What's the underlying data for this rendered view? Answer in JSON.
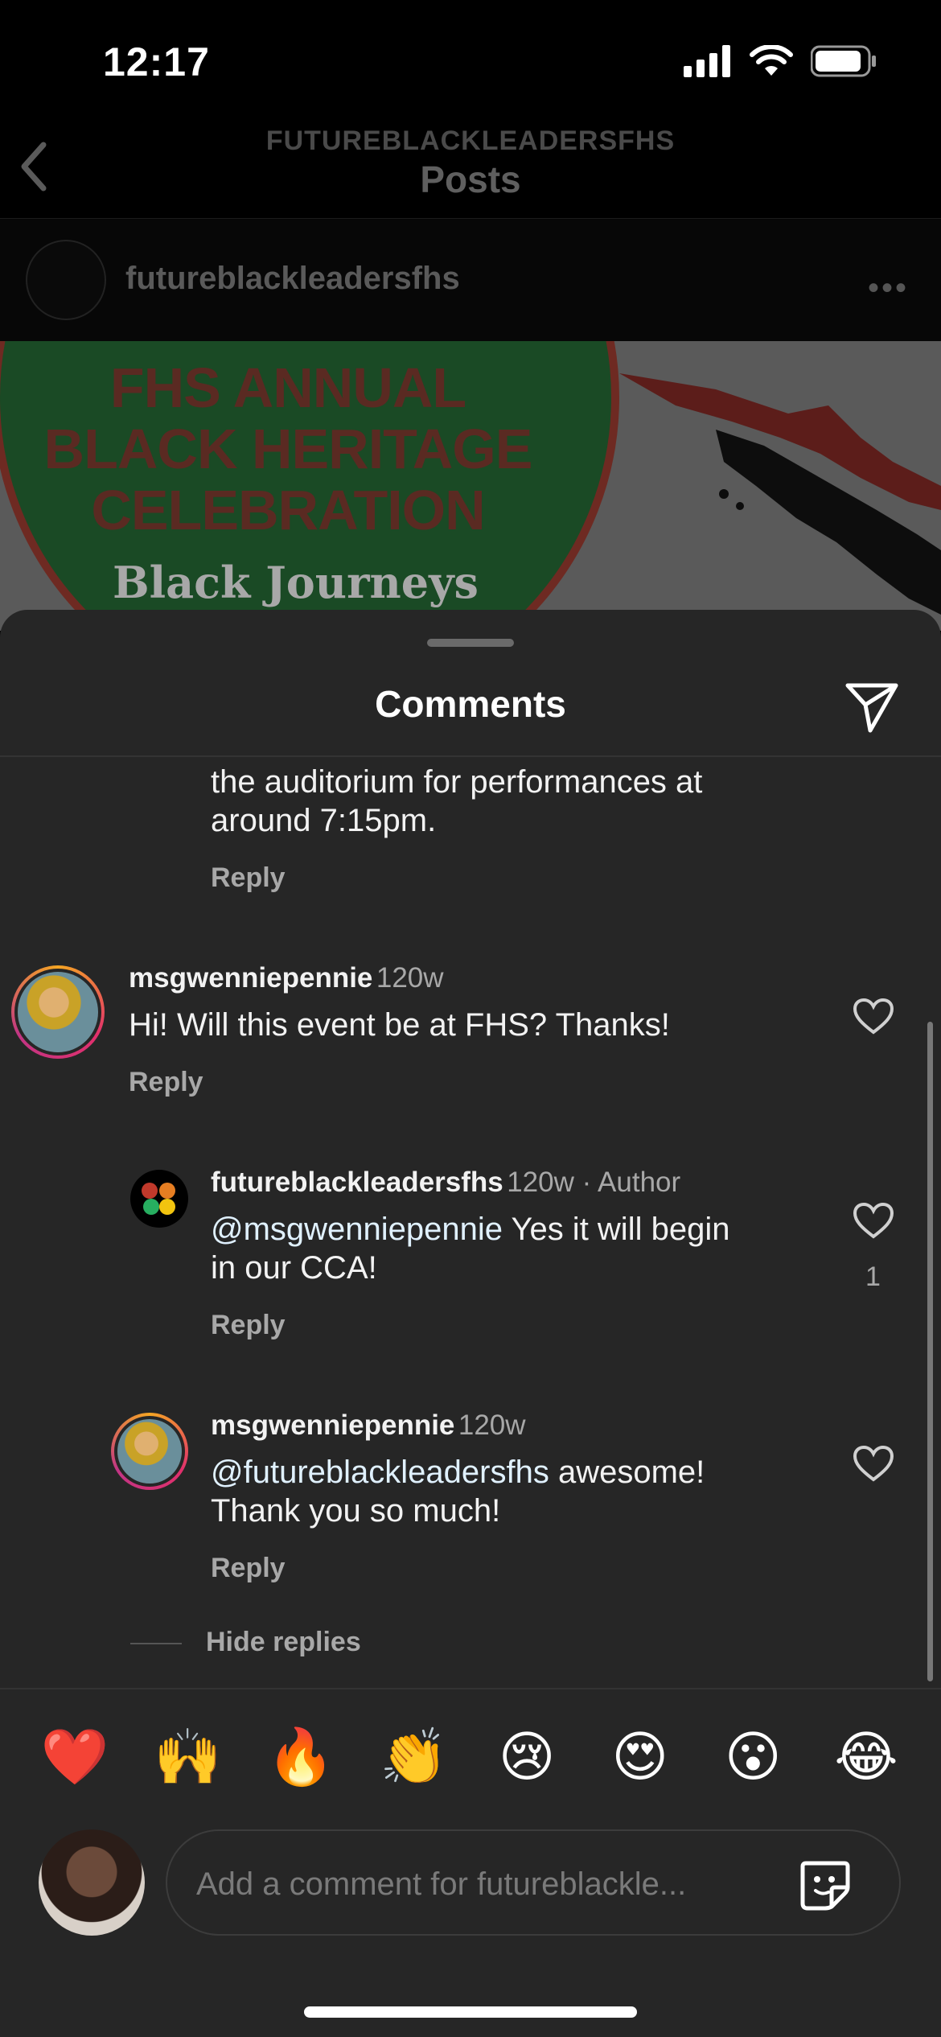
{
  "status_bar": {
    "time": "12:17"
  },
  "header": {
    "account": "FUTUREBLACKLEADERSFHS",
    "title": "Posts"
  },
  "post": {
    "username": "futureblackleadersfhs",
    "image_title_lines": [
      "FHS ANNUAL",
      "BLACK HERITAGE",
      "CELEBRATION"
    ],
    "image_subtitle": "Black Journeys"
  },
  "sheet": {
    "title": "Comments"
  },
  "comments": [
    {
      "text_lines": [
        "the auditorium for performances at",
        "around 7:15pm."
      ],
      "reply_label": "Reply"
    },
    {
      "username": "msgwenniepennie",
      "time": "120w",
      "text": "Hi! Will this event be at FHS? Thanks!",
      "reply_label": "Reply"
    },
    {
      "username": "futureblackleadersfhs",
      "time": "120w · Author",
      "mention": "@msgwenniepennie",
      "text_rest": " Yes it will begin",
      "text_line2": "in our CCA!",
      "likes": "1",
      "reply_label": "Reply"
    },
    {
      "username": "msgwenniepennie",
      "time": "120w",
      "mention": "@futureblackleadersfhs",
      "text_rest": " awesome!",
      "text_line2": "Thank you so much!",
      "reply_label": "Reply"
    }
  ],
  "hide_replies": "Hide replies",
  "emojis": [
    "❤️",
    "🙌",
    "🔥",
    "👏",
    "😢",
    "😍",
    "😮",
    "😂"
  ],
  "composer": {
    "placeholder": "Add a comment for futureblackle..."
  },
  "colors": {
    "sheet_bg": "#262626",
    "mention": "#e0f1ff",
    "muted": "#a8a8a8"
  },
  "icons": [
    "signal-icon",
    "wifi-icon",
    "battery-icon",
    "back-chevron-icon",
    "more-icon",
    "share-icon",
    "heart-icon",
    "sticker-icon"
  ]
}
